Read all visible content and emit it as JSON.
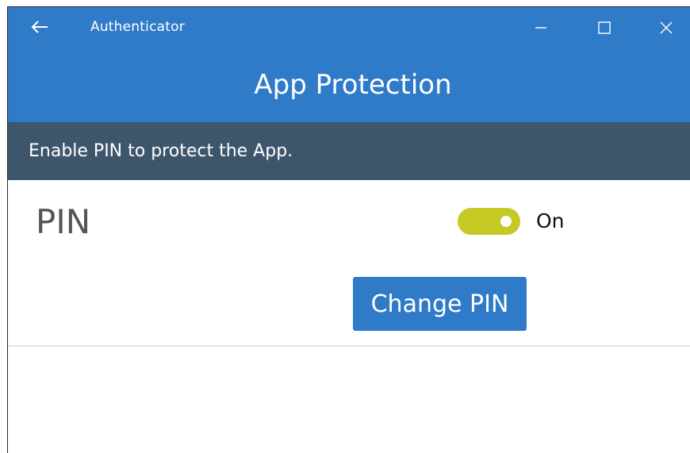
{
  "window": {
    "app_title": "Authenticator",
    "titlebar_color": "#2f7bc8"
  },
  "header": {
    "title": "App Protection"
  },
  "banner": {
    "text": "Enable PIN to protect the App.",
    "color": "#3e566c"
  },
  "pin": {
    "label": "PIN",
    "toggle_state": "On",
    "toggle_on": true,
    "toggle_color": "#c4c924",
    "change_button_label": "Change PIN"
  },
  "icons": {
    "back": "back-arrow-icon",
    "minimize": "minimize-icon",
    "maximize": "maximize-icon",
    "close": "close-icon"
  }
}
